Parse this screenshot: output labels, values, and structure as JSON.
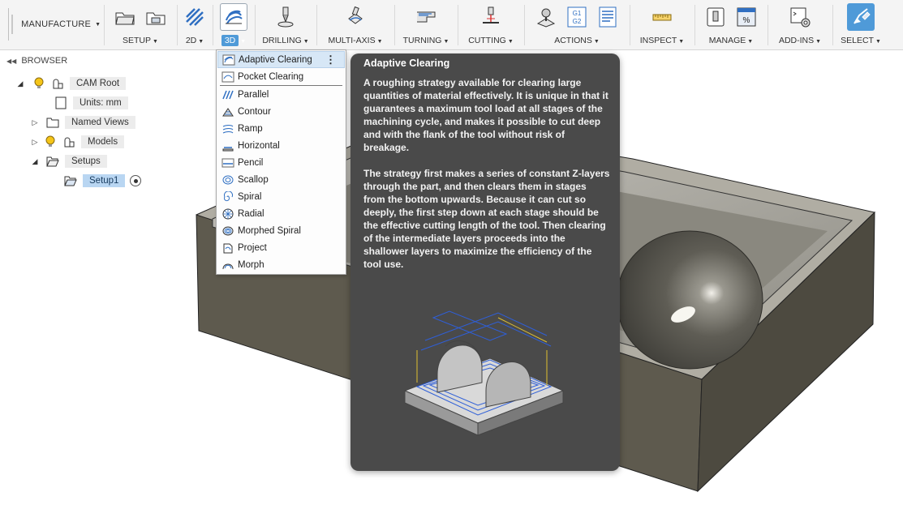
{
  "toolbar": {
    "workspace": "MANUFACTURE",
    "groups": [
      {
        "label": "SETUP"
      },
      {
        "label": "2D"
      },
      {
        "label": "3D"
      },
      {
        "label": "DRILLING"
      },
      {
        "label": "MULTI-AXIS"
      },
      {
        "label": "TURNING"
      },
      {
        "label": "CUTTING"
      },
      {
        "label": "ACTIONS"
      },
      {
        "label": "INSPECT"
      },
      {
        "label": "MANAGE"
      },
      {
        "label": "ADD-INS"
      },
      {
        "label": "SELECT"
      }
    ],
    "actions_icon_text": "G1\nG2",
    "manage_icon_text": "%"
  },
  "browser": {
    "title": "BROWSER",
    "items": [
      {
        "label": "CAM Root"
      },
      {
        "label": "Units: mm"
      },
      {
        "label": "Named Views"
      },
      {
        "label": "Models"
      },
      {
        "label": "Setups"
      },
      {
        "label": "Setup1"
      }
    ]
  },
  "menu": {
    "items": [
      {
        "label": "Adaptive Clearing"
      },
      {
        "label": "Pocket Clearing"
      },
      {
        "label": "Parallel"
      },
      {
        "label": "Contour"
      },
      {
        "label": "Ramp"
      },
      {
        "label": "Horizontal"
      },
      {
        "label": "Pencil"
      },
      {
        "label": "Scallop"
      },
      {
        "label": "Spiral"
      },
      {
        "label": "Radial"
      },
      {
        "label": "Morphed Spiral"
      },
      {
        "label": "Project"
      },
      {
        "label": "Morph"
      }
    ],
    "more_glyph": "⋮"
  },
  "tooltip": {
    "title": "Adaptive Clearing",
    "paragraph1": "A roughing strategy available for clearing large quantities of material effectively. It is unique in that it guarantees a maximum tool load at all stages of the machining cycle, and makes it possible to cut deep and with the flank of the tool without risk of breakage.",
    "paragraph2": "The strategy first makes a series of constant Z-layers through the part, and then clears them in stages from the bottom upwards. Because it can cut so deeply, the first step down at each stage should be the effective cutting length of the tool. Then clearing of the intermediate layers proceeds into the shallower layers to maximize the efficiency of the tool use."
  },
  "colors": {
    "accent": "#4f9ad8",
    "tooltip_bg": "#4a4a4a",
    "menu_highlight": "#d7e7f6",
    "tree_selected": "#b9d6f2"
  }
}
